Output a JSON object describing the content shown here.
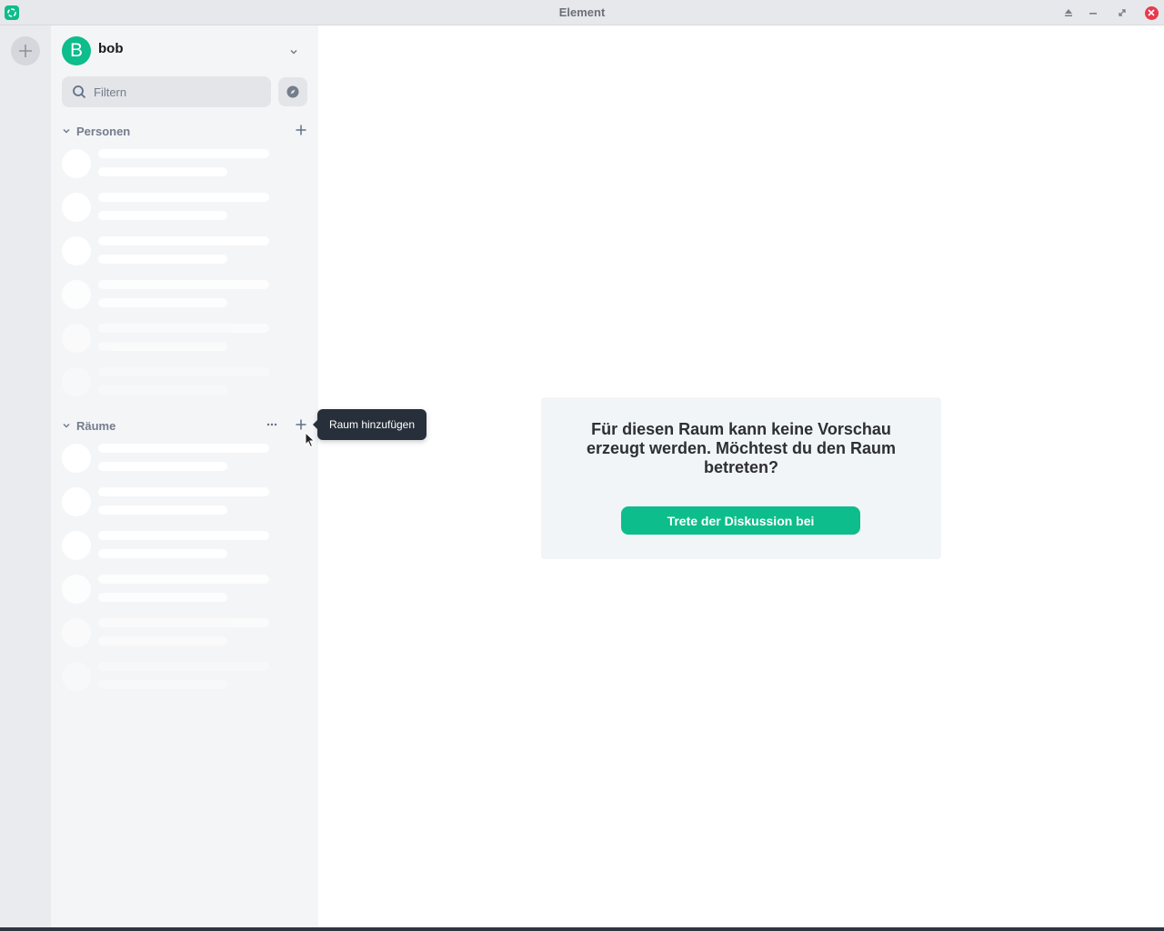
{
  "window": {
    "title": "Element",
    "icons": [
      "element-logo-icon",
      "eject-icon",
      "minimize-icon",
      "maximize-icon",
      "close-icon"
    ]
  },
  "space_panel": {
    "create_space_icon": "plus-icon"
  },
  "user": {
    "avatar_letter": "B",
    "name": "bob",
    "avatar_color": "#0dbd8b"
  },
  "filter": {
    "placeholder": "Filtern"
  },
  "sections": {
    "people": {
      "label": "Personen"
    },
    "rooms": {
      "label": "Räume"
    }
  },
  "tooltip": {
    "text": "Raum hinzufügen"
  },
  "preview": {
    "message": "Für diesen Raum kann keine Vorschau erzeugt werden. Möchtest du den Raum betreten?",
    "join_label": "Trete der Diskussion bei"
  },
  "colors": {
    "accent": "#0dbd8b",
    "close": "#e8394b",
    "tooltip_bg": "#27303a"
  }
}
